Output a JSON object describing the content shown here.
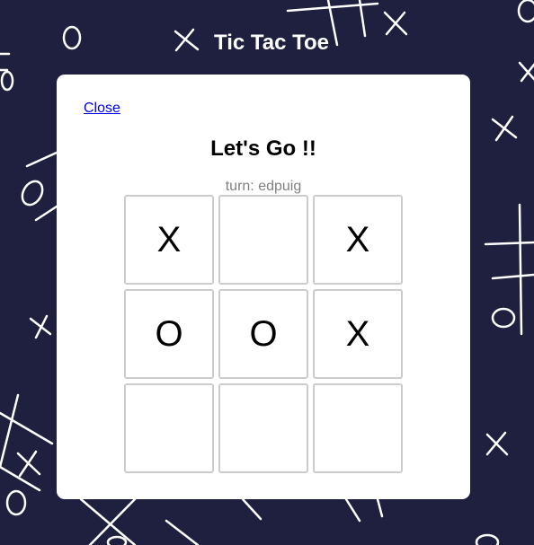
{
  "app": {
    "title": "Tic Tac Toe"
  },
  "modal": {
    "close_label": "Close",
    "heading": "Let's Go !!",
    "turn_text": "turn: edpuig"
  },
  "board": {
    "cells": [
      "X",
      "",
      "X",
      "O",
      "O",
      "X",
      "",
      "",
      ""
    ]
  },
  "colors": {
    "background": "#1f1f3f",
    "modal": "#ffffff",
    "cell_border": "#cccccc",
    "turn_text": "#808080",
    "link": "#0000ee"
  }
}
